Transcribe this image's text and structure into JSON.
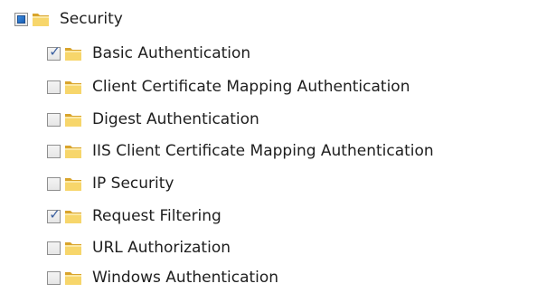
{
  "tree": {
    "parent": {
      "label": "Security",
      "state": "indeterminate"
    },
    "children": [
      {
        "label": "Basic Authentication",
        "checked": true
      },
      {
        "label": "Client Certificate Mapping Authentication",
        "checked": false
      },
      {
        "label": "Digest Authentication",
        "checked": false
      },
      {
        "label": "IIS Client Certificate Mapping Authentication",
        "checked": false
      },
      {
        "label": "IP Security",
        "checked": false
      },
      {
        "label": "Request Filtering",
        "checked": true
      },
      {
        "label": "URL Authorization",
        "checked": false
      },
      {
        "label": "Windows Authentication",
        "checked": false
      }
    ]
  },
  "icons": {
    "folder": "folder-icon",
    "checkbox": "checkbox"
  },
  "colors": {
    "folder_light": "#f7d66b",
    "folder_dark": "#d9a42b",
    "check": "#3a5fa0",
    "tristate": "#1a5fb4"
  }
}
